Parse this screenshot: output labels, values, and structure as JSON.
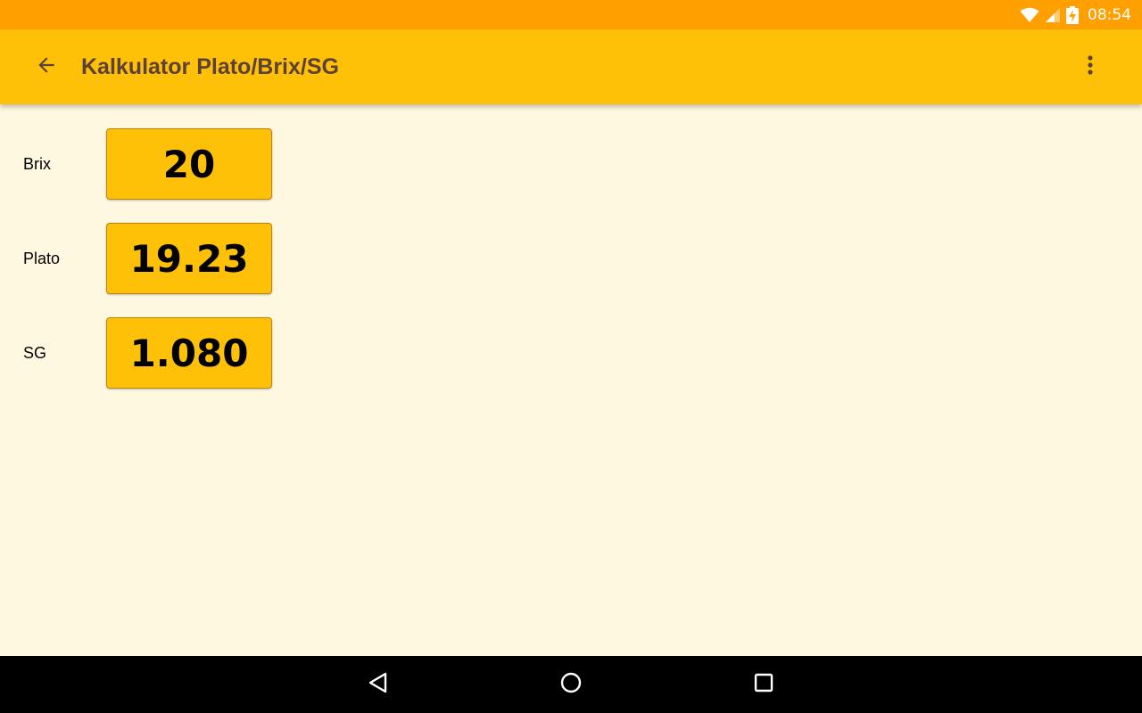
{
  "status_bar": {
    "time": "08:54",
    "icons": [
      "wifi-icon",
      "signal-icon",
      "battery-charging-icon"
    ]
  },
  "app_bar": {
    "title": "Kalkulator Plato/Brix/SG",
    "back_icon": "arrow-back-icon",
    "menu_icon": "more-vert-icon"
  },
  "fields": [
    {
      "label": "Brix",
      "value": "20"
    },
    {
      "label": "Plato",
      "value": "19.23"
    },
    {
      "label": "SG",
      "value": "1.080"
    }
  ],
  "nav_bar": {
    "icons": [
      "back-triangle-icon",
      "home-circle-icon",
      "recents-square-icon"
    ]
  },
  "colors": {
    "status_bar": "#FFA000",
    "app_bar": "#FFC107",
    "title_text": "#5D4037",
    "background": "#FFF8E1",
    "value_box": "#FFC107",
    "nav_bar": "#000000"
  }
}
